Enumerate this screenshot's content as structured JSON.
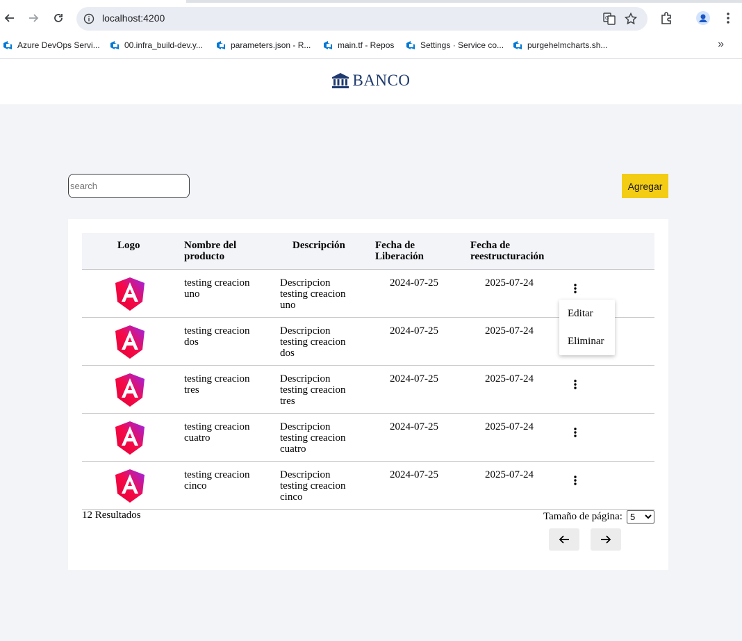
{
  "browser": {
    "url": "localhost:4200",
    "bookmarks": [
      "Azure DevOps Servi...",
      "00.infra_build-dev.y...",
      "parameters.json - R...",
      "main.tf - Repos",
      "Settings · Service co...",
      "purgehelmcharts.sh..."
    ]
  },
  "header": {
    "brand": "BANCO"
  },
  "toolbar": {
    "search_placeholder": "search",
    "add_label": "Agregar"
  },
  "table": {
    "columns": {
      "logo": "Logo",
      "name_l1": "Nombre del",
      "name_l2": "producto",
      "desc": "Descripción",
      "release_l1": "Fecha de",
      "release_l2": "Liberación",
      "restruct_l1": "Fecha de",
      "restruct_l2": "reestructuración"
    },
    "rows": [
      {
        "name_l1": "testing creacion",
        "name_l2": "uno",
        "desc_l1": "Descripcion",
        "desc_l2": "testing creacion",
        "desc_l3": "uno",
        "release": "2024-07-25",
        "restruct": "2025-07-24"
      },
      {
        "name_l1": "testing creacion",
        "name_l2": "dos",
        "desc_l1": "Descripcion",
        "desc_l2": "testing creacion",
        "desc_l3": "dos",
        "release": "2024-07-25",
        "restruct": "2025-07-24"
      },
      {
        "name_l1": "testing creacion",
        "name_l2": "tres",
        "desc_l1": "Descripcion",
        "desc_l2": "testing creacion",
        "desc_l3": "tres",
        "release": "2024-07-25",
        "restruct": "2025-07-24"
      },
      {
        "name_l1": "testing creacion",
        "name_l2": "cuatro",
        "desc_l1": "Descripcion",
        "desc_l2": "testing creacion",
        "desc_l3": "cuatro",
        "release": "2024-07-25",
        "restruct": "2025-07-24"
      },
      {
        "name_l1": "testing creacion",
        "name_l2": "cinco",
        "desc_l1": "Descripcion",
        "desc_l2": "testing creacion",
        "desc_l3": "cinco",
        "release": "2024-07-25",
        "restruct": "2025-07-24"
      }
    ]
  },
  "menu": {
    "edit": "Editar",
    "delete": "Eliminar"
  },
  "footer": {
    "results": "12 Resultados",
    "page_size_label": "Tamaño de página:",
    "page_size_value": "5"
  },
  "colors": {
    "accent": "#f3cc14",
    "brand": "#1e3a6e",
    "page_bg": "#f3f4f8"
  },
  "icons": {
    "logo": "angular-logo-icon",
    "actions": "more-vert-icon"
  }
}
